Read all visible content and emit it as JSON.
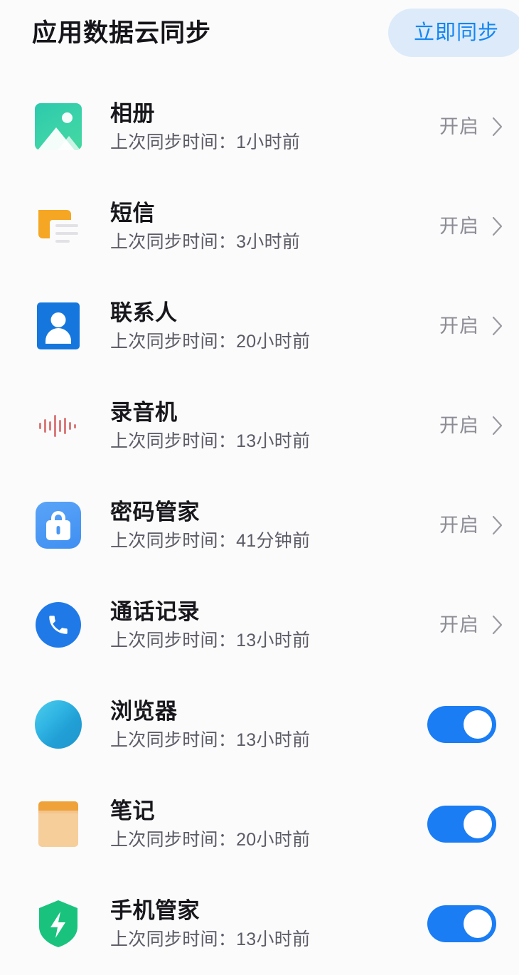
{
  "header": {
    "title": "应用数据云同步",
    "sync_button_label": "立即同步",
    "button_bg_color": "#DCEAFA",
    "button_text_color": "#1286F2"
  },
  "common": {
    "status_on_label": "开启",
    "sub_prefix": "上次同步时间："
  },
  "theme": {
    "page_bg": "#FBFBFC",
    "title_color": "#15151A",
    "row_title_color": "#17171C",
    "row_sub_color": "#5C5C66",
    "status_color": "#8C8C95",
    "toggle_on_color": "#1A7DF4"
  },
  "items": [
    {
      "name": "相册",
      "subtitle": "上次同步时间：1小时前",
      "last_sync": "1小时前",
      "control": "link",
      "status": "开启",
      "icon": "gallery-icon",
      "icon_color": "#3BD3A8"
    },
    {
      "name": "短信",
      "subtitle": "上次同步时间：3小时前",
      "last_sync": "3小时前",
      "control": "link",
      "status": "开启",
      "icon": "messages-icon",
      "icon_color": "#F5A623"
    },
    {
      "name": "联系人",
      "subtitle": "上次同步时间：20小时前",
      "last_sync": "20小时前",
      "control": "link",
      "status": "开启",
      "icon": "contacts-icon",
      "icon_color": "#1577DE"
    },
    {
      "name": "录音机",
      "subtitle": "上次同步时间：13小时前",
      "last_sync": "13小时前",
      "control": "link",
      "status": "开启",
      "icon": "recorder-waveform-icon",
      "icon_color": "#D97B7B"
    },
    {
      "name": "密码管家",
      "subtitle": "上次同步时间：41分钟前",
      "last_sync": "41分钟前",
      "control": "link",
      "status": "开启",
      "icon": "lock-icon",
      "icon_color": "#4A97F4"
    },
    {
      "name": "通话记录",
      "subtitle": "上次同步时间：13小时前",
      "last_sync": "13小时前",
      "control": "link",
      "status": "开启",
      "icon": "phone-icon",
      "icon_color": "#1F7AE8"
    },
    {
      "name": "浏览器",
      "subtitle": "上次同步时间：13小时前",
      "last_sync": "13小时前",
      "control": "toggle",
      "toggle_on": true,
      "icon": "browser-icon",
      "icon_color": "#2FB4E3"
    },
    {
      "name": "笔记",
      "subtitle": "上次同步时间：20小时前",
      "last_sync": "20小时前",
      "control": "toggle",
      "toggle_on": true,
      "icon": "notes-icon",
      "icon_color": "#F6CE9A"
    },
    {
      "name": "手机管家",
      "subtitle": "上次同步时间：13小时前",
      "last_sync": "13小时前",
      "control": "toggle",
      "toggle_on": true,
      "icon": "shield-bolt-icon",
      "icon_color": "#19C37D"
    }
  ]
}
